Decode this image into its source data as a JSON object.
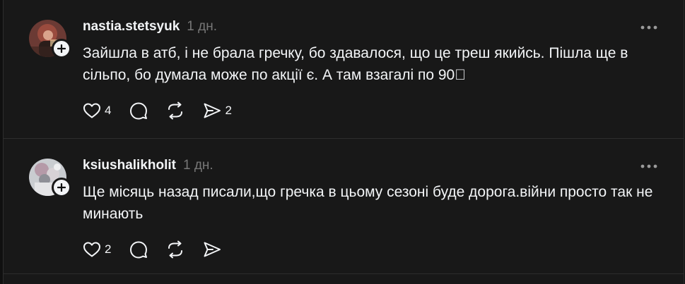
{
  "posts": [
    {
      "username": "nastia.stetsyuk",
      "time": "1 дн.",
      "text": "Зайшла в атб, і не брала гречку, бо здавалося, що це треш якийсь. Пішла ще в сільпо, бо думала може по акції є. А там взагалі по 90\u0000",
      "likes": "4",
      "shares": "2"
    },
    {
      "username": "ksiushalikholit",
      "time": "1 дн.",
      "text": "Ще місяць назад писали,що гречка в цьому сезоні буде дорога.війни просто так не минають",
      "likes": "2",
      "shares": ""
    }
  ]
}
